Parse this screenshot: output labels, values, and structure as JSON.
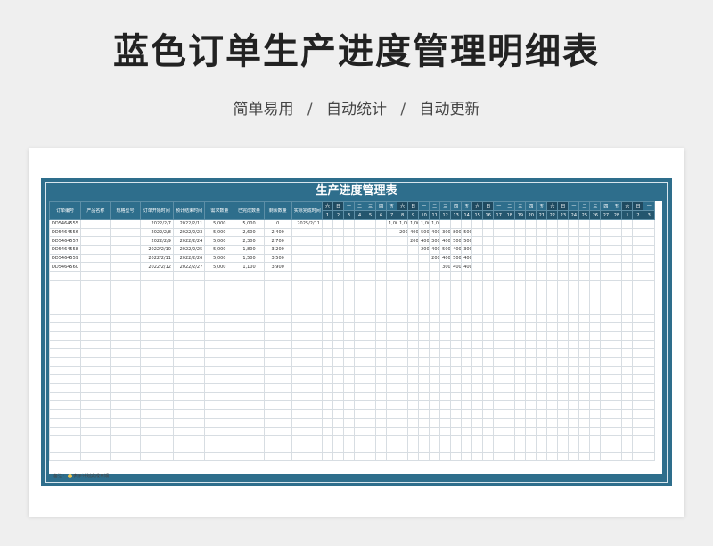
{
  "page": {
    "title": "蓝色订单生产进度管理明细表",
    "subtitle": [
      "简单易用",
      "自动统计",
      "自动更新"
    ],
    "separator": "/"
  },
  "sheet": {
    "title": "生产进度管理表",
    "columns": [
      "订单编号",
      "产品名称",
      "规格型号",
      "订单开始时间",
      "预计结束时间",
      "需求数量",
      "已完成数量",
      "剩余数量",
      "实际完成时间"
    ],
    "weekdays": [
      "六",
      "日",
      "一",
      "二",
      "三",
      "四",
      "五",
      "六",
      "日",
      "一",
      "二",
      "三",
      "四",
      "五",
      "六",
      "日",
      "一",
      "二",
      "三",
      "四",
      "五",
      "六",
      "日",
      "一",
      "二",
      "三",
      "四",
      "五",
      "六",
      "日",
      "一"
    ],
    "dates": [
      "1",
      "2",
      "3",
      "4",
      "5",
      "6",
      "7",
      "8",
      "9",
      "10",
      "11",
      "12",
      "13",
      "14",
      "15",
      "16",
      "17",
      "18",
      "19",
      "20",
      "21",
      "22",
      "23",
      "24",
      "25",
      "26",
      "27",
      "28",
      "1",
      "2",
      "3"
    ],
    "rows": [
      {
        "id": "DD5464555",
        "name": "",
        "spec": "",
        "start": "2022/2/7",
        "end": "2022/2/11",
        "qty": "5,000",
        "done": "5,000",
        "left": "0",
        "actual": "2025/2/11",
        "daily": {
          "6": "1,000",
          "7": "1,000",
          "8": "1,000",
          "9": "1,000",
          "10": "1,000"
        }
      },
      {
        "id": "DD5464556",
        "name": "",
        "spec": "",
        "start": "2022/2/8",
        "end": "2022/2/23",
        "qty": "5,000",
        "done": "2,600",
        "left": "2,400",
        "actual": "",
        "daily": {
          "7": "200",
          "8": "400",
          "9": "500",
          "10": "400",
          "11": "300",
          "12": "800",
          "13": "500"
        }
      },
      {
        "id": "DD5464557",
        "name": "",
        "spec": "",
        "start": "2022/2/9",
        "end": "2022/2/24",
        "qty": "5,000",
        "done": "2,300",
        "left": "2,700",
        "actual": "",
        "daily": {
          "8": "200",
          "9": "400",
          "10": "300",
          "11": "400",
          "12": "500",
          "13": "500"
        }
      },
      {
        "id": "DD5464558",
        "name": "",
        "spec": "",
        "start": "2022/2/10",
        "end": "2022/2/25",
        "qty": "5,000",
        "done": "1,800",
        "left": "3,200",
        "actual": "",
        "daily": {
          "9": "200",
          "10": "400",
          "11": "500",
          "12": "400",
          "13": "300"
        }
      },
      {
        "id": "DD5464559",
        "name": "",
        "spec": "",
        "start": "2022/2/11",
        "end": "2022/2/26",
        "qty": "5,000",
        "done": "1,500",
        "left": "3,500",
        "actual": "",
        "daily": {
          "10": "200",
          "11": "400",
          "12": "500",
          "13": "400"
        }
      },
      {
        "id": "DD5464560",
        "name": "",
        "spec": "",
        "start": "2022/2/12",
        "end": "2022/2/27",
        "qty": "5,000",
        "done": "1,100",
        "left": "3,900",
        "actual": "",
        "daily": {
          "11": "300",
          "12": "400",
          "13": "400"
        }
      }
    ],
    "empty_rows": 22,
    "note_prefix": "备注：",
    "note_text": "表示计划完成日期",
    "note_color": "#f1c64d",
    "header_color": "#2e6e8c"
  }
}
